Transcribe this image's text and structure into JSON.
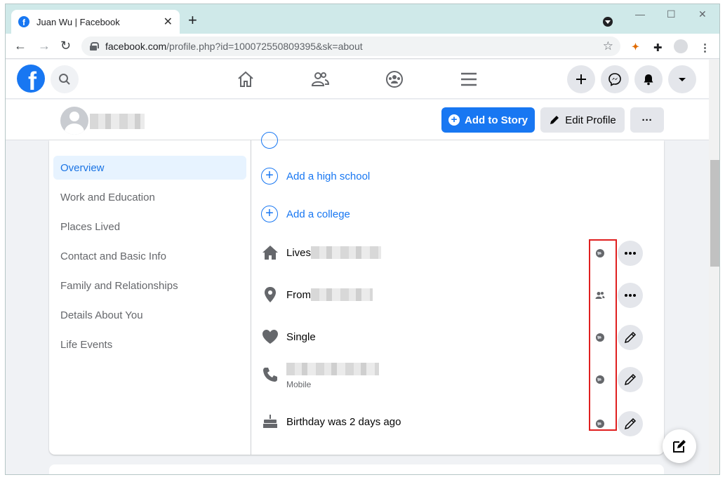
{
  "browser": {
    "tab_title": "Juan Wu | Facebook",
    "tab_close": "✕",
    "new_tab": "+",
    "url_domain": "facebook.com",
    "url_path": "/profile.php?id=100072550809395&sk=about",
    "window_controls": [
      "—",
      "☐",
      "✕"
    ],
    "nav": {
      "back": "←",
      "forward": "→",
      "reload": "↻"
    }
  },
  "profile_bar": {
    "add_story_label": "Add to Story",
    "edit_profile_label": "Edit Profile",
    "more_label": "···"
  },
  "sidebar": {
    "items": [
      {
        "label": "Overview",
        "active": true
      },
      {
        "label": "Work and Education",
        "active": false
      },
      {
        "label": "Places Lived",
        "active": false
      },
      {
        "label": "Contact and Basic Info",
        "active": false
      },
      {
        "label": "Family and Relationships",
        "active": false
      },
      {
        "label": "Details About You",
        "active": false
      },
      {
        "label": "Life Events",
        "active": false
      }
    ]
  },
  "overview": {
    "add_high_school": "Add a high school",
    "add_college": "Add a college",
    "lives_label": "Lives",
    "from_label": "From",
    "relationship": "Single",
    "phone_sub": "Mobile",
    "birthday": "Birthday was 2 days ago",
    "privacy": [
      "public-globe-icon",
      "friends-icon",
      "public-globe-icon",
      "public-globe-icon",
      "public-globe-icon"
    ]
  },
  "colors": {
    "brand": "#1877f2",
    "highlight": "#e01f1f",
    "active_nav_bg": "#e7f3ff"
  }
}
